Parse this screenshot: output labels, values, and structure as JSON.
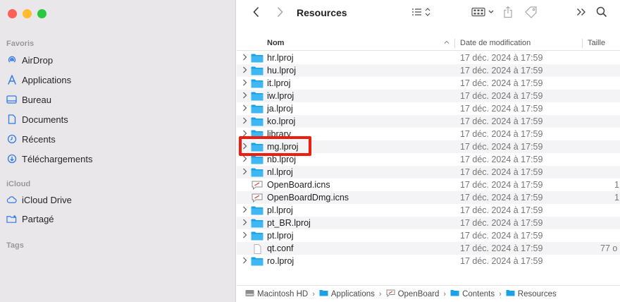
{
  "toolbar": {
    "title": "Resources"
  },
  "sidebar": {
    "favorites_label": "Favoris",
    "favorites": [
      {
        "label": "AirDrop",
        "icon": "airdrop-icon"
      },
      {
        "label": "Applications",
        "icon": "applications-icon"
      },
      {
        "label": "Bureau",
        "icon": "desktop-icon"
      },
      {
        "label": "Documents",
        "icon": "document-icon"
      },
      {
        "label": "Récents",
        "icon": "clock-icon"
      },
      {
        "label": "Téléchargements",
        "icon": "download-icon"
      }
    ],
    "icloud_label": "iCloud",
    "icloud": [
      {
        "label": "iCloud Drive",
        "icon": "cloud-icon"
      },
      {
        "label": "Partagé",
        "icon": "shared-folder-icon"
      }
    ],
    "tags_label": "Tags"
  },
  "columns": {
    "name": "Nom",
    "date": "Date de modification",
    "size": "Taille"
  },
  "files": [
    {
      "name": "hr.lproj",
      "date": "17 déc. 2024 à 17:59",
      "size": "",
      "kind": "folder"
    },
    {
      "name": "hu.lproj",
      "date": "17 déc. 2024 à 17:59",
      "size": "",
      "kind": "folder"
    },
    {
      "name": "it.lproj",
      "date": "17 déc. 2024 à 17:59",
      "size": "",
      "kind": "folder"
    },
    {
      "name": "iw.lproj",
      "date": "17 déc. 2024 à 17:59",
      "size": "",
      "kind": "folder"
    },
    {
      "name": "ja.lproj",
      "date": "17 déc. 2024 à 17:59",
      "size": "",
      "kind": "folder"
    },
    {
      "name": "ko.lproj",
      "date": "17 déc. 2024 à 17:59",
      "size": "",
      "kind": "folder"
    },
    {
      "name": "library",
      "date": "17 déc. 2024 à 17:59",
      "size": "",
      "kind": "folder"
    },
    {
      "name": "mg.lproj",
      "date": "17 déc. 2024 à 17:59",
      "size": "",
      "kind": "folder"
    },
    {
      "name": "nb.lproj",
      "date": "17 déc. 2024 à 17:59",
      "size": "",
      "kind": "folder"
    },
    {
      "name": "nl.lproj",
      "date": "17 déc. 2024 à 17:59",
      "size": "",
      "kind": "folder"
    },
    {
      "name": "OpenBoard.icns",
      "date": "17 déc. 2024 à 17:59",
      "size": "1",
      "kind": "icns"
    },
    {
      "name": "OpenBoardDmg.icns",
      "date": "17 déc. 2024 à 17:59",
      "size": "1",
      "kind": "icns"
    },
    {
      "name": "pl.lproj",
      "date": "17 déc. 2024 à 17:59",
      "size": "",
      "kind": "folder"
    },
    {
      "name": "pt_BR.lproj",
      "date": "17 déc. 2024 à 17:59",
      "size": "",
      "kind": "folder"
    },
    {
      "name": "pt.lproj",
      "date": "17 déc. 2024 à 17:59",
      "size": "",
      "kind": "folder"
    },
    {
      "name": "qt.conf",
      "date": "17 déc. 2024 à 17:59",
      "size": "77 o",
      "kind": "file"
    },
    {
      "name": "ro.lproj",
      "date": "17 déc. 2024 à 17:59",
      "size": "",
      "kind": "folder"
    }
  ],
  "pathbar": [
    "Macintosh HD",
    "Applications",
    "OpenBoard",
    "Contents",
    "Resources"
  ],
  "colors": {
    "folder": "#1aa1e6",
    "highlight": "#ee1d0e"
  }
}
